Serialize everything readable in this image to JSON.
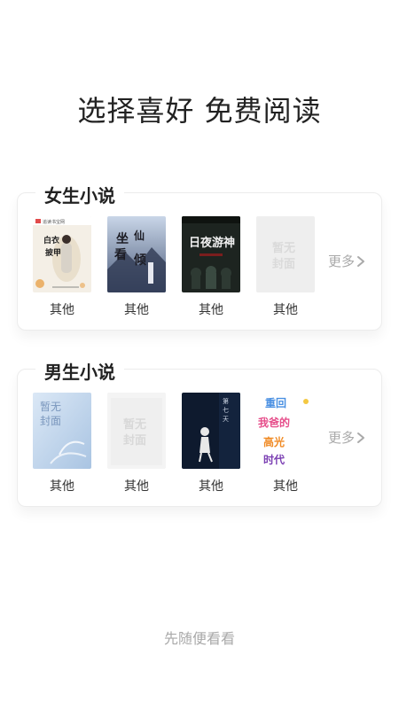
{
  "page": {
    "title": "选择喜好 免费阅读",
    "skip_label": "先随便看看"
  },
  "female": {
    "section_title": "女生小说",
    "more_label": "更多",
    "books": [
      {
        "label": "其他",
        "cover_text": "白衣披甲",
        "cover_badge": "追读书宝网"
      },
      {
        "label": "其他",
        "cover_text": "坐看仙倾"
      },
      {
        "label": "其他",
        "cover_text": "日夜游神"
      },
      {
        "label": "其他",
        "cover_text": "暂无封面"
      }
    ]
  },
  "male": {
    "section_title": "男生小说",
    "more_label": "更多",
    "books": [
      {
        "label": "其他",
        "cover_text": "暂无封面"
      },
      {
        "label": "其他",
        "cover_text": "暂无封面"
      },
      {
        "label": "其他",
        "cover_text": "第七天"
      },
      {
        "label": "其他",
        "cover_text": "重回我爸的高光时代"
      }
    ]
  },
  "colors": {
    "title": "#222222",
    "muted": "#a9a9a9",
    "border": "#ececec"
  }
}
